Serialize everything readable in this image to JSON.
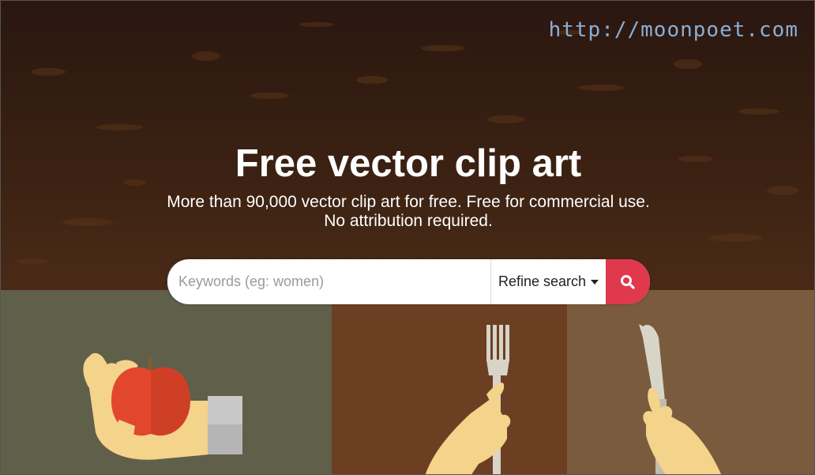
{
  "watermark": "http://moonpoet.com",
  "hero": {
    "title": "Free vector clip art",
    "subtitle_line1": "More than 90,000 vector clip art for free. Free for commercial use.",
    "subtitle_line2": "No attribution required."
  },
  "search": {
    "placeholder": "Keywords (eg: women)",
    "value": "",
    "refine_label": "Refine search",
    "button_icon": "search-icon",
    "button_color": "#e0384c"
  },
  "colors": {
    "background_top": "#2a1710",
    "panel_left": "#5f5f4a",
    "panel_mid": "#6d3f22",
    "panel_right": "#7b5b3e",
    "accent": "#e0384c",
    "watermark": "#8aaed6"
  },
  "illustrations": [
    "hand-holding-apple",
    "hand-holding-fork",
    "hand-holding-knife"
  ]
}
